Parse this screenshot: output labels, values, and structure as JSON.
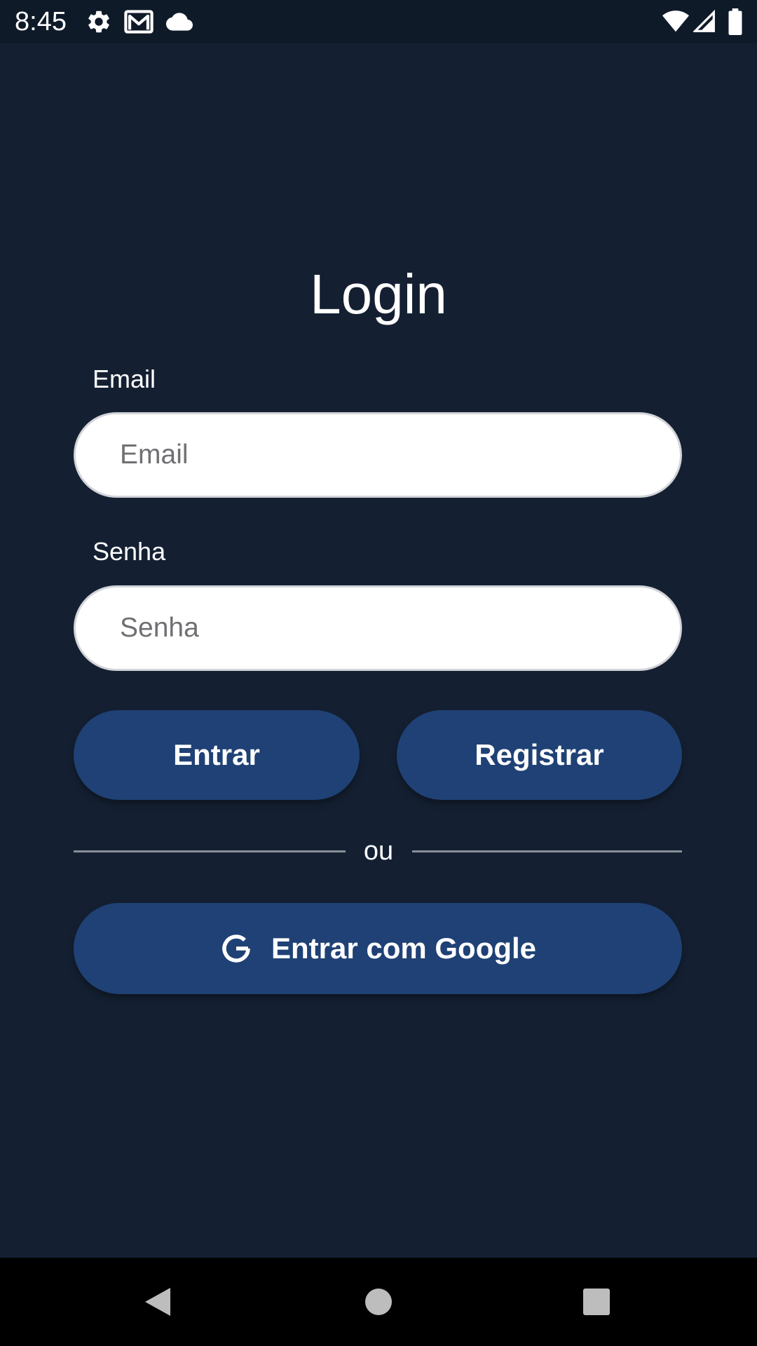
{
  "status_bar": {
    "time": "8:45",
    "icons": [
      "gear-icon",
      "gmail-icon",
      "cloud-icon",
      "wifi-icon",
      "signal-icon",
      "battery-icon"
    ]
  },
  "login": {
    "title": "Login",
    "email_label": "Email",
    "email_placeholder": "Email",
    "email_value": "",
    "password_label": "Senha",
    "password_placeholder": "Senha",
    "password_value": "",
    "enter_button": "Entrar",
    "register_button": "Registrar",
    "divider_text": "ou",
    "google_button": "Entrar com Google"
  },
  "nav_bar": {
    "buttons": [
      "back-icon",
      "home-icon",
      "recents-icon"
    ]
  },
  "colors": {
    "background": "#142032",
    "button": "#1f4175",
    "status_bar": "#0f1a29",
    "nav_bar": "#000000"
  }
}
